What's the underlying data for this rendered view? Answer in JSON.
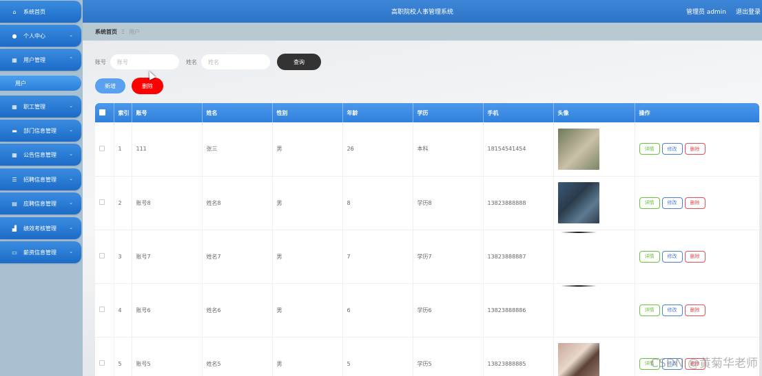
{
  "header": {
    "title": "高职院校人事管理系统",
    "user": "管理员 admin",
    "logout": "退出登录"
  },
  "sidebar": {
    "items": [
      {
        "label": "系统首页",
        "icon": "home-icon"
      },
      {
        "label": "个人中心",
        "icon": "user-icon"
      },
      {
        "label": "用户管理",
        "icon": "grid-icon",
        "expanded": true,
        "sub": "用户"
      },
      {
        "label": "职工管理",
        "icon": "grid-icon"
      },
      {
        "label": "部门信息管理",
        "icon": "briefcase-icon"
      },
      {
        "label": "公告信息管理",
        "icon": "grid-icon"
      },
      {
        "label": "招聘信息管理",
        "icon": "sliders-icon"
      },
      {
        "label": "应聘信息管理",
        "icon": "document-icon"
      },
      {
        "label": "绩效考核管理",
        "icon": "chart-icon"
      },
      {
        "label": "薪资信息管理",
        "icon": "monitor-icon"
      }
    ]
  },
  "breadcrumb": {
    "home": "系统首页",
    "separator": "Ξ",
    "current": "用户"
  },
  "search": {
    "account_label": "账号",
    "account_placeholder": "账号",
    "name_label": "姓名",
    "name_placeholder": "姓名",
    "query_button": "查询"
  },
  "actions": {
    "add": "新增",
    "delete": "删除"
  },
  "table": {
    "columns": [
      "索引",
      "账号",
      "姓名",
      "性别",
      "年龄",
      "学历",
      "手机",
      "头像",
      "操作"
    ],
    "rows": [
      {
        "index": "1",
        "account": "111",
        "name": "张三",
        "gender": "男",
        "age": "26",
        "education": "本科",
        "phone": "18154541454",
        "avatar": "photo"
      },
      {
        "index": "2",
        "account": "账号8",
        "name": "姓名8",
        "gender": "男",
        "age": "8",
        "education": "学历8",
        "phone": "13823888888",
        "avatar": "photo"
      },
      {
        "index": "3",
        "account": "账号7",
        "name": "姓名7",
        "gender": "男",
        "age": "7",
        "education": "学历7",
        "phone": "13823888887",
        "avatar": "partial"
      },
      {
        "index": "4",
        "account": "账号6",
        "name": "姓名6",
        "gender": "男",
        "age": "6",
        "education": "学历6",
        "phone": "13823888886",
        "avatar": "partial"
      },
      {
        "index": "5",
        "account": "账号5",
        "name": "姓名5",
        "gender": "男",
        "age": "5",
        "education": "学历5",
        "phone": "13823888885",
        "avatar": "photo"
      }
    ],
    "ops": {
      "detail": "详情",
      "edit": "修改",
      "delete": "删除"
    }
  },
  "watermark": "CSDN @黄菊华老师",
  "colors": {
    "primary": "#2f80dc",
    "danger": "#ff0000",
    "success": "#67c23a"
  }
}
